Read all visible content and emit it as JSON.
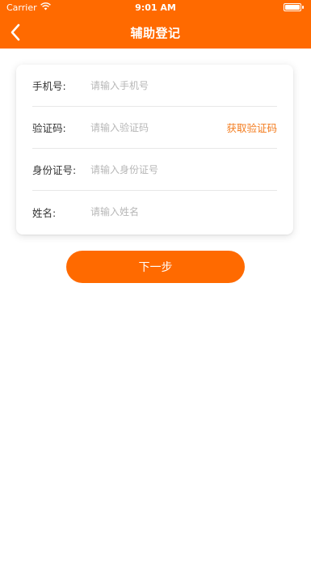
{
  "status_bar": {
    "carrier": "Carrier",
    "time": "9:01 AM"
  },
  "nav": {
    "title": "辅助登记",
    "back_icon": "chevron-left-icon"
  },
  "form": {
    "phone": {
      "label": "手机号:",
      "placeholder": "请输入手机号",
      "value": ""
    },
    "code": {
      "label": "验证码:",
      "placeholder": "请输入验证码",
      "value": "",
      "action": "获取验证码"
    },
    "id_number": {
      "label": "身份证号:",
      "placeholder": "请输入身份证号",
      "value": ""
    },
    "name": {
      "label": "姓名:",
      "placeholder": "请输入姓名",
      "value": ""
    }
  },
  "actions": {
    "next_label": "下一步"
  },
  "colors": {
    "primary": "#ff6a00",
    "link": "#f37b1d"
  }
}
